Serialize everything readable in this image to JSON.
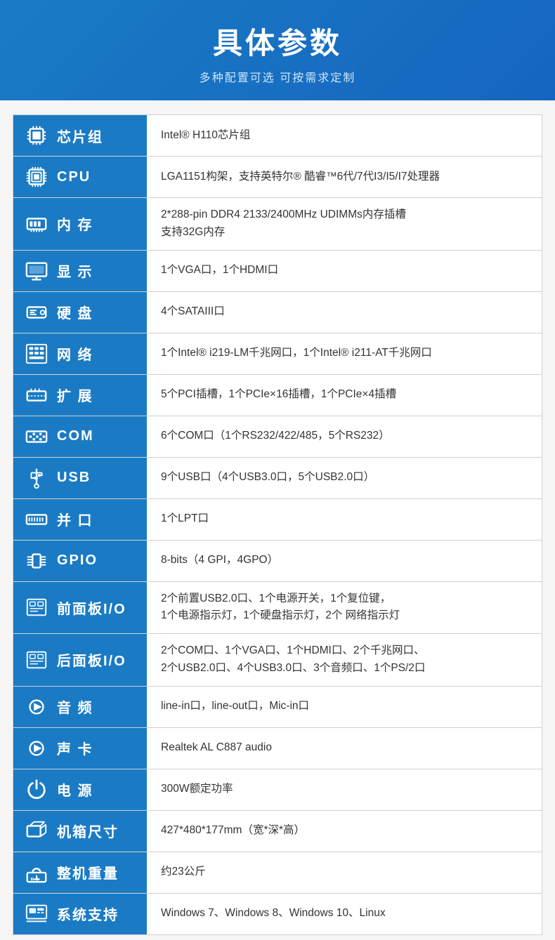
{
  "header": {
    "title": "具体参数",
    "subtitle": "多种配置可选 可按需求定制"
  },
  "rows": [
    {
      "id": "chipset",
      "label": "芯片组",
      "value": "Intel® H110芯片组",
      "icon": "chipset"
    },
    {
      "id": "cpu",
      "label": "CPU",
      "value": "LGA1151构架，支持英特尔® 酷睿™6代/7代I3/I5/I7处理器",
      "icon": "cpu"
    },
    {
      "id": "memory",
      "label": "内 存",
      "value": "2*288-pin DDR4 2133/2400MHz UDIMMs内存插槽\n支持32G内存",
      "icon": "memory"
    },
    {
      "id": "display",
      "label": "显 示",
      "value": "1个VGA口，1个HDMI口",
      "icon": "display"
    },
    {
      "id": "hdd",
      "label": "硬 盘",
      "value": "4个SATAIII口",
      "icon": "hdd"
    },
    {
      "id": "network",
      "label": "网 络",
      "value": "1个Intel® i219-LM千兆网口，1个Intel® i211-AT千兆网口",
      "icon": "network"
    },
    {
      "id": "expansion",
      "label": "扩 展",
      "value": "5个PCI插槽，1个PCIe×16插槽，1个PCIe×4插槽",
      "icon": "expansion"
    },
    {
      "id": "com",
      "label": "COM",
      "value": "6个COM口（1个RS232/422/485，5个RS232）",
      "icon": "com"
    },
    {
      "id": "usb",
      "label": "USB",
      "value": "9个USB口（4个USB3.0口，5个USB2.0口）",
      "icon": "usb"
    },
    {
      "id": "parallel",
      "label": "并 口",
      "value": "1个LPT口",
      "icon": "parallel"
    },
    {
      "id": "gpio",
      "label": "GPIO",
      "value": "8-bits（4 GPI，4GPO）",
      "icon": "gpio"
    },
    {
      "id": "frontio",
      "label": "前面板I/O",
      "value": "2个前置USB2.0口、1个电源开关，1个复位键，\n1个电源指示灯，1个硬盘指示灯，2个 网络指示灯",
      "icon": "frontio"
    },
    {
      "id": "reario",
      "label": "后面板I/O",
      "value": "2个COM口、1个VGA口、1个HDMI口、2个千兆网口、\n2个USB2.0口、4个USB3.0口、3个音频口、1个PS/2口",
      "icon": "reario"
    },
    {
      "id": "audio",
      "label": "音 频",
      "value": "line-in口，line-out口，Mic-in口",
      "icon": "audio"
    },
    {
      "id": "soundcard",
      "label": "声 卡",
      "value": "Realtek AL C887 audio",
      "icon": "soundcard"
    },
    {
      "id": "power",
      "label": "电 源",
      "value": "300W额定功率",
      "icon": "power"
    },
    {
      "id": "dimensions",
      "label": "机箱尺寸",
      "value": "427*480*177mm（宽*深*高）",
      "icon": "dimensions"
    },
    {
      "id": "weight",
      "label": "整机重量",
      "value": "约23公斤",
      "icon": "weight"
    },
    {
      "id": "os",
      "label": "系统支持",
      "value": "Windows 7、Windows 8、Windows 10、Linux",
      "icon": "os"
    }
  ]
}
